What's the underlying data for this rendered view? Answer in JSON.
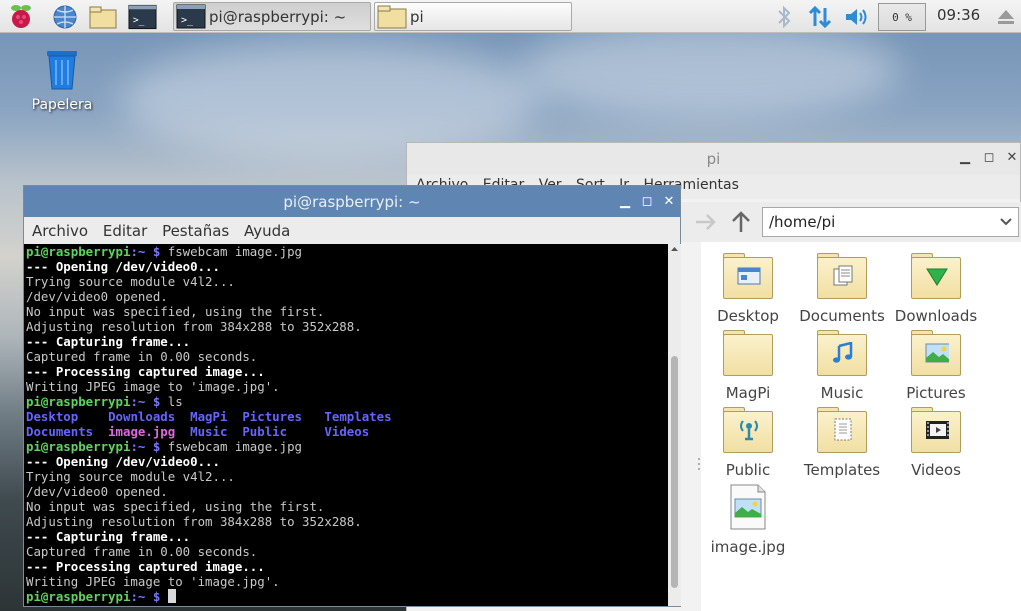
{
  "taskbar": {
    "tasks": [
      {
        "label": "pi@raspberrypi: ~",
        "active": true
      },
      {
        "label": "pi",
        "active": false
      }
    ],
    "cpu": "0 %",
    "clock": "09:36"
  },
  "desktop": {
    "trash_label": "Papelera"
  },
  "file_manager": {
    "title": "pi",
    "menu": [
      "Archivo",
      "Editar",
      "Ver",
      "Sort",
      "Ir",
      "Herramientas"
    ],
    "path": "/home/pi",
    "items": [
      {
        "label": "Desktop",
        "icon": "desktop-folder-icon"
      },
      {
        "label": "Documents",
        "icon": "documents-folder-icon"
      },
      {
        "label": "Downloads",
        "icon": "downloads-folder-icon"
      },
      {
        "label": "MagPi",
        "icon": "folder-icon"
      },
      {
        "label": "Music",
        "icon": "music-folder-icon"
      },
      {
        "label": "Pictures",
        "icon": "pictures-folder-icon"
      },
      {
        "label": "Public",
        "icon": "public-folder-icon"
      },
      {
        "label": "Templates",
        "icon": "templates-folder-icon"
      },
      {
        "label": "Videos",
        "icon": "videos-folder-icon"
      },
      {
        "label": "image.jpg",
        "icon": "image-file-icon"
      }
    ]
  },
  "terminal": {
    "title": "pi@raspberrypi: ~",
    "menu": [
      "Archivo",
      "Editar",
      "Pestañas",
      "Ayuda"
    ],
    "prompt_user": "pi@raspberrypi",
    "prompt_path": ":~ $",
    "lines": [
      {
        "kind": "prompt",
        "text": " fswebcam image.jpg"
      },
      {
        "kind": "bold",
        "text": "--- Opening /dev/video0..."
      },
      {
        "kind": "normal",
        "text": "Trying source module v4l2..."
      },
      {
        "kind": "normal",
        "text": "/dev/video0 opened."
      },
      {
        "kind": "normal",
        "text": "No input was specified, using the first."
      },
      {
        "kind": "normal",
        "text": "Adjusting resolution from 384x288 to 352x288."
      },
      {
        "kind": "bold",
        "text": "--- Capturing frame..."
      },
      {
        "kind": "normal",
        "text": "Captured frame in 0.00 seconds."
      },
      {
        "kind": "bold",
        "text": "--- Processing captured image..."
      },
      {
        "kind": "normal",
        "text": "Writing JPEG image to 'image.jpg'."
      },
      {
        "kind": "prompt",
        "text": " ls"
      },
      {
        "kind": "ls",
        "cols": [
          [
            "Desktop",
            "dir"
          ],
          [
            "Downloads",
            "dir"
          ],
          [
            "MagPi",
            "dir"
          ],
          [
            "Pictures",
            "dir"
          ],
          [
            "Templates",
            "dir"
          ]
        ]
      },
      {
        "kind": "ls",
        "cols": [
          [
            "Documents",
            "dir"
          ],
          [
            "image.jpg",
            "img"
          ],
          [
            "Music",
            "dir"
          ],
          [
            "Public",
            "dir"
          ],
          [
            "Videos",
            "dir"
          ]
        ]
      },
      {
        "kind": "prompt",
        "text": " fswebcam image.jpg"
      },
      {
        "kind": "bold",
        "text": "--- Opening /dev/video0..."
      },
      {
        "kind": "normal",
        "text": "Trying source module v4l2..."
      },
      {
        "kind": "normal",
        "text": "/dev/video0 opened."
      },
      {
        "kind": "normal",
        "text": "No input was specified, using the first."
      },
      {
        "kind": "normal",
        "text": "Adjusting resolution from 384x288 to 352x288."
      },
      {
        "kind": "bold",
        "text": "--- Capturing frame..."
      },
      {
        "kind": "normal",
        "text": "Captured frame in 0.00 seconds."
      },
      {
        "kind": "bold",
        "text": "--- Processing captured image..."
      },
      {
        "kind": "normal",
        "text": "Writing JPEG image to 'image.jpg'."
      },
      {
        "kind": "prompt",
        "text": " ",
        "cursor": true
      }
    ]
  },
  "colors": {
    "terminal_title": "#5f86b3",
    "prompt_user": "#5fd35f",
    "directory": "#6464ff",
    "image_file": "#d96ad9",
    "panel_accent": "#2e8bd6"
  }
}
